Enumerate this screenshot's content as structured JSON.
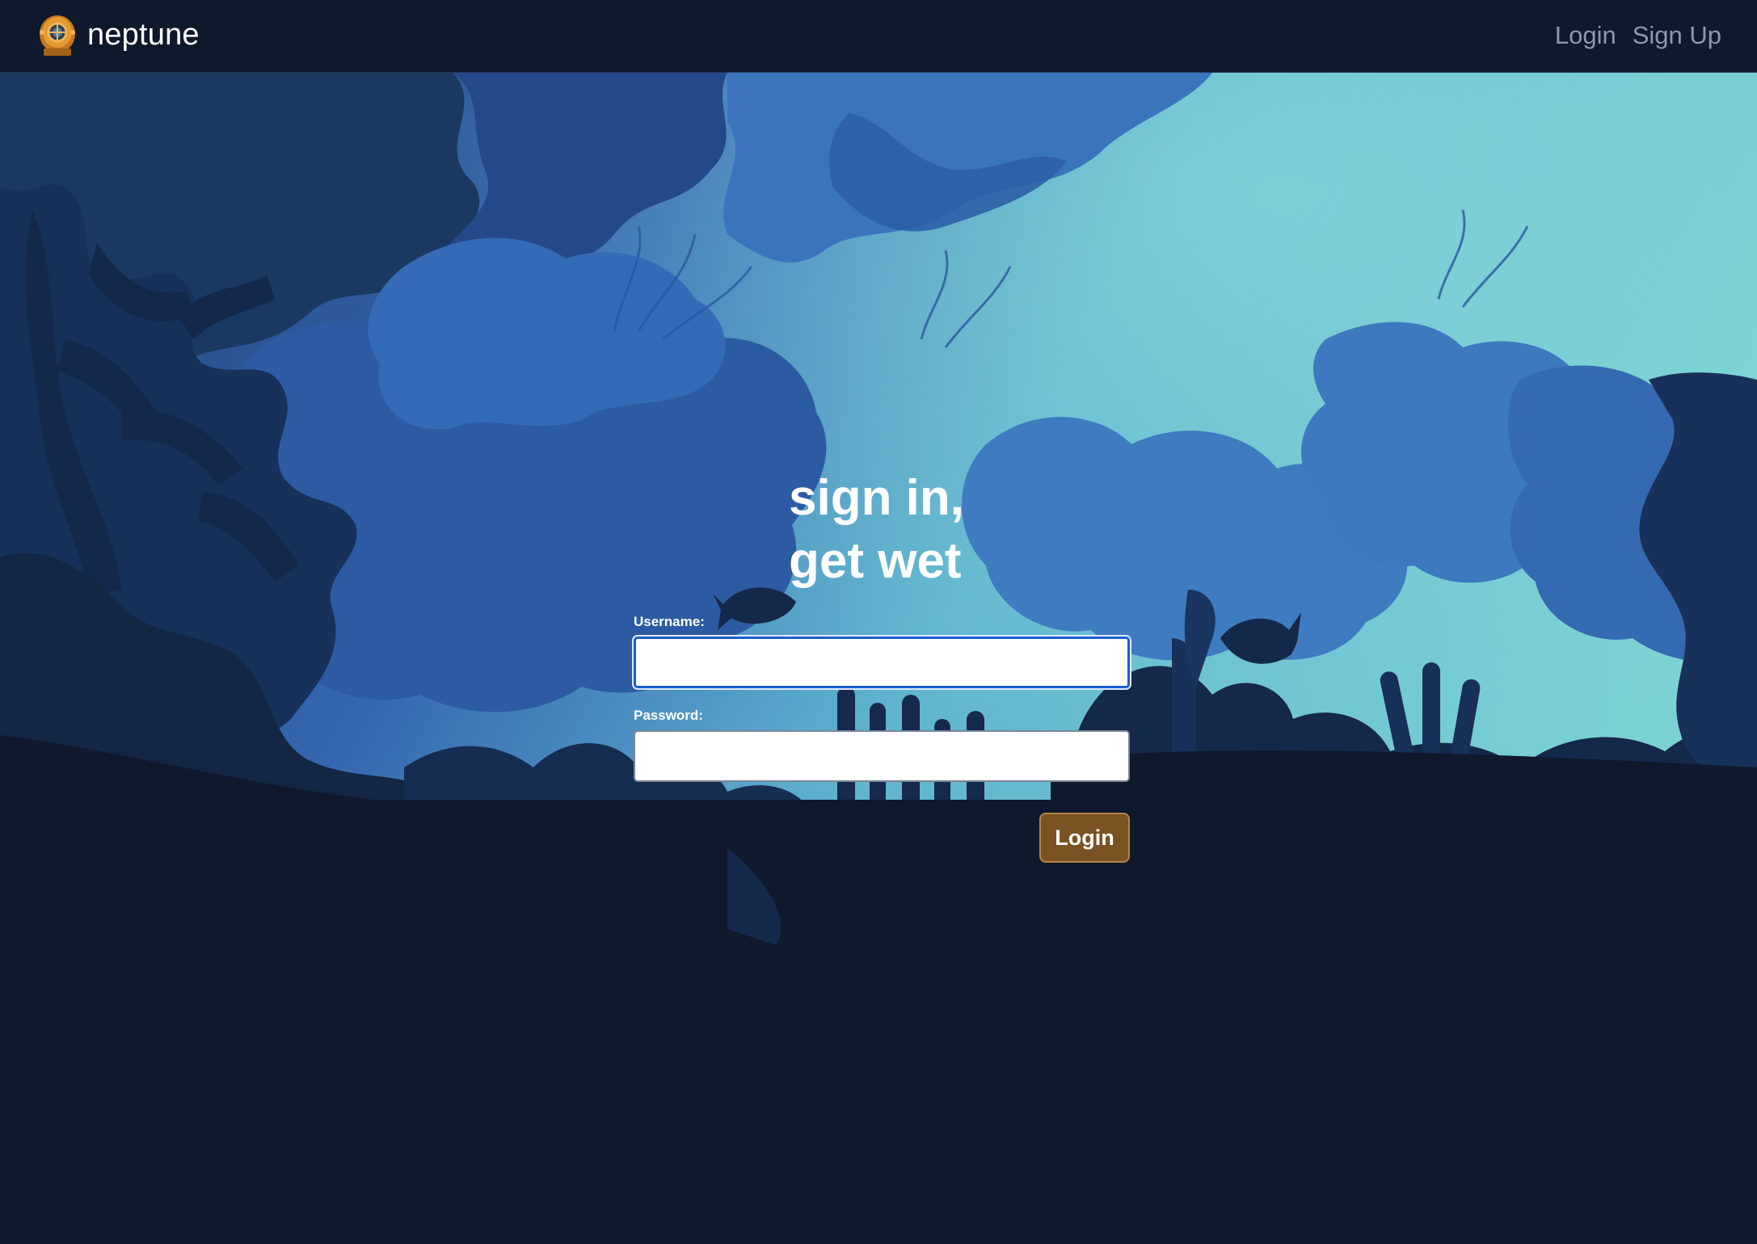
{
  "navbar": {
    "brand_name": "neptune",
    "logo_icon": "diving-helmet-icon",
    "links": [
      {
        "label": "Login"
      },
      {
        "label": "Sign Up"
      }
    ]
  },
  "hero": {
    "heading_line_1": "sign in,",
    "heading_line_2": "get wet"
  },
  "form": {
    "username_label": "Username:",
    "username_value": "",
    "password_label": "Password:",
    "password_value": "",
    "submit_label": "Login"
  },
  "colors": {
    "background": "#0e192c",
    "navbar": "#0f192c",
    "button_fill": "#7a5223",
    "button_border": "#b18442",
    "focus_ring": "#1b5fd1"
  }
}
